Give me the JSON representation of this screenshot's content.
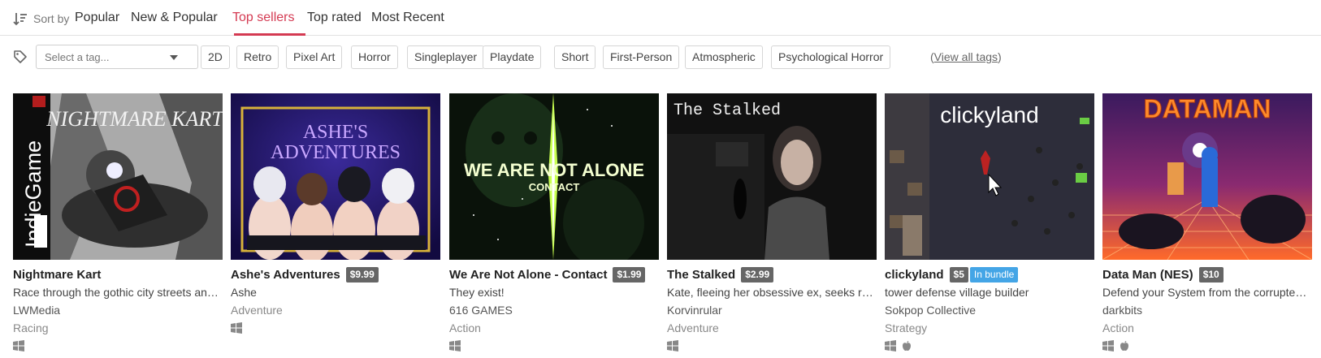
{
  "sort": {
    "label": "Sort by",
    "tabs": [
      {
        "label": "Popular",
        "active": false
      },
      {
        "label": "New & Popular",
        "active": false
      },
      {
        "label": "Top sellers",
        "active": true
      },
      {
        "label": "Top rated",
        "active": false
      },
      {
        "label": "Most Recent",
        "active": false
      }
    ]
  },
  "tags": {
    "select_placeholder": "Select a tag...",
    "chips": [
      "2D",
      "Retro",
      "Pixel Art",
      "Horror",
      "Singleplayer",
      "Playdate",
      "Short",
      "First-Person",
      "Atmospheric",
      "Psychological Horror"
    ],
    "view_all_prefix": "(",
    "view_all": "View all tags",
    "view_all_suffix": ")"
  },
  "games": [
    {
      "title": "Nightmare Kart",
      "price": "",
      "bundle": "",
      "description": "Race through the gothic city streets and ...",
      "author": "LWMedia",
      "genre": "Racing",
      "platforms": [
        "windows-icon"
      ],
      "cover_text": "NIGHTMARE KART",
      "cover_side_text": "IndieGame"
    },
    {
      "title": "Ashe's Adventures",
      "price": "$9.99",
      "bundle": "",
      "description": "Ashe",
      "author": "Adventure",
      "genre": "",
      "platforms": [
        "windows-icon"
      ],
      "cover_text_1": "ASHE'S",
      "cover_text_2": "ADVENTURES"
    },
    {
      "title": "We Are Not Alone - Contact",
      "price": "$1.99",
      "bundle": "",
      "description": "They exist!",
      "author": "616 GAMES",
      "genre": "Action",
      "platforms": [
        "windows-icon"
      ],
      "cover_text_1": "WE ARE NOT ALONE",
      "cover_text_2": "CONTACT"
    },
    {
      "title": "The Stalked",
      "price": "$2.99",
      "bundle": "",
      "description": "Kate, fleeing her obsessive ex, seeks refu...",
      "author": "Korvinrular",
      "genre": "Adventure",
      "platforms": [
        "windows-icon"
      ],
      "cover_text": "The Stalked"
    },
    {
      "title": "clickyland",
      "price": "$5",
      "bundle": "In bundle",
      "description": "tower defense village builder",
      "author": "Sokpop Collective",
      "genre": "Strategy",
      "platforms": [
        "windows-icon",
        "apple-icon"
      ],
      "cover_text": "clickyland"
    },
    {
      "title": "Data Man (NES)",
      "price": "$10",
      "bundle": "",
      "description": "Defend your System from the corrupted ...",
      "author": "darkbits",
      "genre": "Action",
      "platforms": [
        "windows-icon",
        "apple-icon"
      ],
      "cover_text": "DATAMAN"
    }
  ],
  "colors": {
    "accent": "#d43a52",
    "price_badge": "#666666",
    "bundle_badge": "#44a5e6"
  }
}
